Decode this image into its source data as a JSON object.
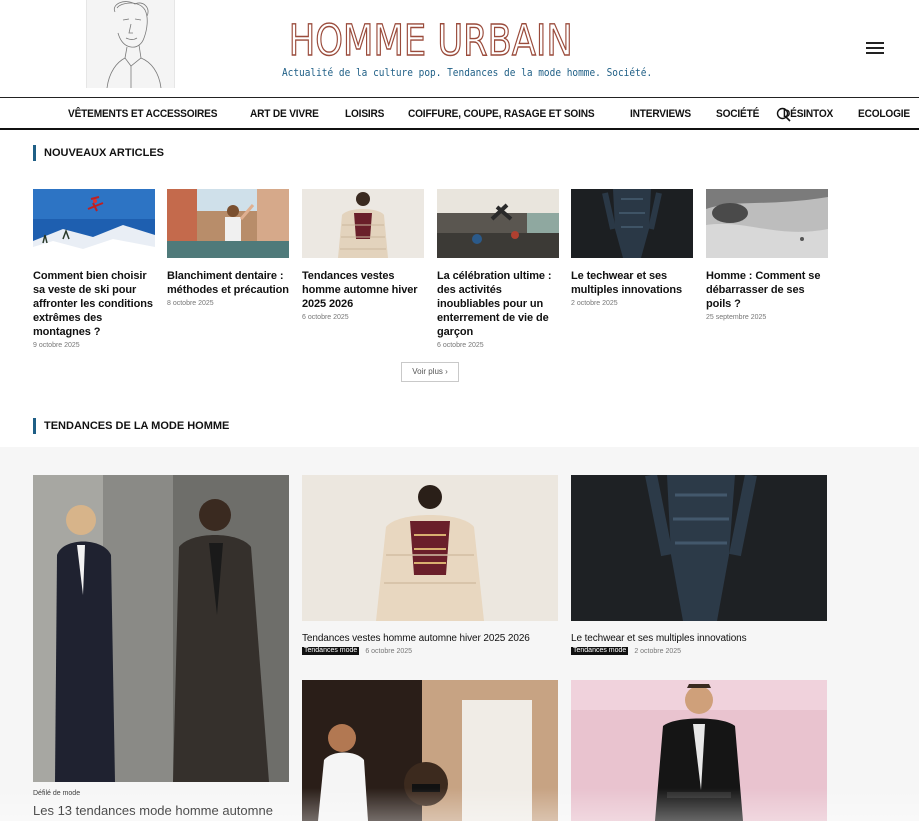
{
  "brand": {
    "title": "HOMME URBAIN",
    "tagline": "Actualité de la culture pop. Tendances de la mode homme. Société."
  },
  "nav": {
    "items": [
      {
        "label": "VÊTEMENTS ET ACCESSOIRES"
      },
      {
        "label": "ART DE VIVRE"
      },
      {
        "label": "LOISIRS"
      },
      {
        "label": "COIFFURE, COUPE, RASAGE ET SOINS"
      },
      {
        "label": "INTERVIEWS"
      },
      {
        "label": "SOCIÉTÉ"
      },
      {
        "label": "DÉSINTOX"
      },
      {
        "label": "ECOLOGIE"
      }
    ],
    "search_icon": "search-icon",
    "menu_icon": "hamburger-menu-icon"
  },
  "new_articles": {
    "heading": "NOUVEAUX ARTICLES",
    "items": [
      {
        "title": "Comment bien choisir sa veste de ski pour affronter les conditions extrêmes des montagnes ?",
        "date": "9 octobre 2025"
      },
      {
        "title": "Blanchiment dentaire : méthodes et précaution",
        "date": "8 octobre 2025"
      },
      {
        "title": "Tendances vestes homme automne hiver 2025 2026",
        "date": "6 octobre 2025"
      },
      {
        "title": "La célébration ultime : des activités inoubliables pour un enterrement de vie de garçon",
        "date": "6 octobre 2025"
      },
      {
        "title": "Le techwear et ses multiples innovations",
        "date": "2 octobre 2025"
      },
      {
        "title": "Homme : Comment se débarrasser de ses poils ?",
        "date": "25 septembre 2025"
      }
    ],
    "more_label": "Voir plus"
  },
  "trends": {
    "heading": "TENDANCES DE LA MODE HOMME",
    "featured": {
      "category": "Défilé de mode",
      "title": "Les 13 tendances mode homme automne"
    },
    "cards": [
      {
        "title": "Tendances vestes homme automne hiver 2025 2026",
        "category": "Tendances mode",
        "date": "6 octobre 2025"
      },
      {
        "title": "Le techwear et ses multiples innovations",
        "category": "Tendances mode",
        "date": "2 octobre 2025"
      }
    ]
  },
  "colors": {
    "accent": "#1f5f86",
    "brand": "#9a4b3b"
  }
}
